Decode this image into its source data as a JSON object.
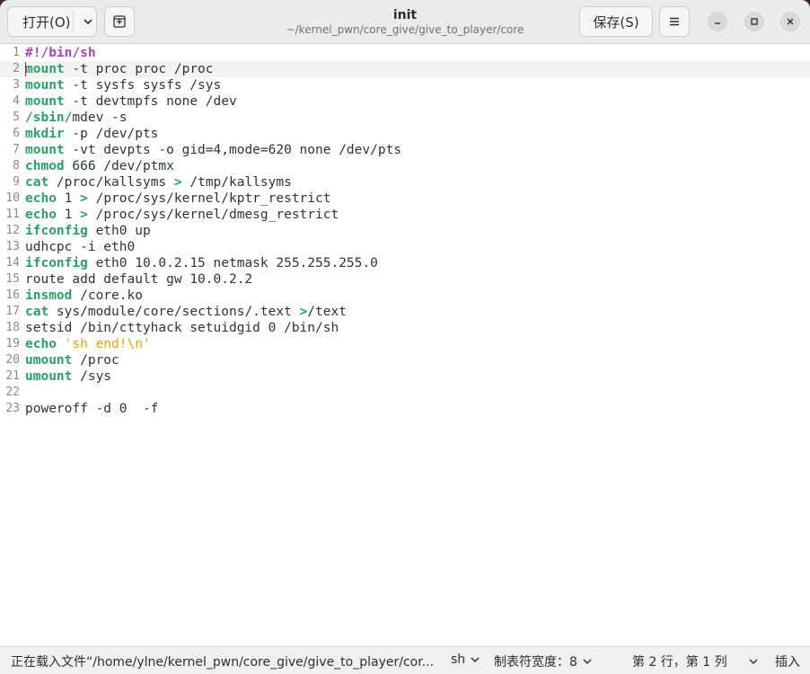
{
  "header": {
    "open_label": "打开(O)",
    "save_label": "保存(S)",
    "title": "init",
    "subtitle": "~/kernel_pwn/core_give/give_to_player/core"
  },
  "editor": {
    "current_line": 2,
    "lines": [
      {
        "n": "1",
        "segs": [
          {
            "t": "#!/bin/sh",
            "c": "sb"
          }
        ]
      },
      {
        "n": "2",
        "segs": [
          {
            "t": "mount",
            "c": "kw"
          },
          {
            "t": " -t proc proc /proc",
            "c": "plain"
          }
        ]
      },
      {
        "n": "3",
        "segs": [
          {
            "t": "mount",
            "c": "kw"
          },
          {
            "t": " -t sysfs sysfs /sys",
            "c": "plain"
          }
        ]
      },
      {
        "n": "4",
        "segs": [
          {
            "t": "mount",
            "c": "kw"
          },
          {
            "t": " -t devtmpfs none /dev",
            "c": "plain"
          }
        ]
      },
      {
        "n": "5",
        "segs": [
          {
            "t": "/sbin/",
            "c": "kw"
          },
          {
            "t": "mdev -s",
            "c": "plain"
          }
        ]
      },
      {
        "n": "6",
        "segs": [
          {
            "t": "mkdir",
            "c": "kw"
          },
          {
            "t": " -p /dev/pts",
            "c": "plain"
          }
        ]
      },
      {
        "n": "7",
        "segs": [
          {
            "t": "mount",
            "c": "kw"
          },
          {
            "t": " -vt devpts -o gid=4,mode=620 none /dev/pts",
            "c": "plain"
          }
        ]
      },
      {
        "n": "8",
        "segs": [
          {
            "t": "chmod",
            "c": "kw"
          },
          {
            "t": " 666 /dev/ptmx",
            "c": "plain"
          }
        ]
      },
      {
        "n": "9",
        "segs": [
          {
            "t": "cat",
            "c": "kw"
          },
          {
            "t": " /proc/kallsyms ",
            "c": "plain"
          },
          {
            "t": ">",
            "c": "op"
          },
          {
            "t": " /tmp/kallsyms",
            "c": "plain"
          }
        ]
      },
      {
        "n": "10",
        "segs": [
          {
            "t": "echo",
            "c": "kw"
          },
          {
            "t": " 1 ",
            "c": "plain"
          },
          {
            "t": ">",
            "c": "op"
          },
          {
            "t": " /proc/sys/kernel/kptr_restrict",
            "c": "plain"
          }
        ]
      },
      {
        "n": "11",
        "segs": [
          {
            "t": "echo",
            "c": "kw"
          },
          {
            "t": " 1 ",
            "c": "plain"
          },
          {
            "t": ">",
            "c": "op"
          },
          {
            "t": " /proc/sys/kernel/dmesg_restrict",
            "c": "plain"
          }
        ]
      },
      {
        "n": "12",
        "segs": [
          {
            "t": "ifconfig",
            "c": "kw"
          },
          {
            "t": " eth0 up",
            "c": "plain"
          }
        ]
      },
      {
        "n": "13",
        "segs": [
          {
            "t": "udhcpc -i eth0",
            "c": "plain"
          }
        ]
      },
      {
        "n": "14",
        "segs": [
          {
            "t": "ifconfig",
            "c": "kw"
          },
          {
            "t": " eth0 10.0.2.15 netmask 255.255.255.0",
            "c": "plain"
          }
        ]
      },
      {
        "n": "15",
        "segs": [
          {
            "t": "route add default gw 10.0.2.2",
            "c": "plain"
          }
        ]
      },
      {
        "n": "16",
        "segs": [
          {
            "t": "insmod",
            "c": "kw"
          },
          {
            "t": " /core.ko",
            "c": "plain"
          }
        ]
      },
      {
        "n": "17",
        "segs": [
          {
            "t": "cat",
            "c": "kw"
          },
          {
            "t": " sys/module/core/sections/.text ",
            "c": "plain"
          },
          {
            "t": ">",
            "c": "op"
          },
          {
            "t": "/text",
            "c": "plain"
          }
        ]
      },
      {
        "n": "18",
        "segs": [
          {
            "t": "setsid /bin/cttyhack setuidgid 0 /bin/sh",
            "c": "plain"
          }
        ]
      },
      {
        "n": "19",
        "segs": [
          {
            "t": "echo",
            "c": "kw"
          },
          {
            "t": " ",
            "c": "plain"
          },
          {
            "t": "'sh end!\\n'",
            "c": "str"
          }
        ]
      },
      {
        "n": "20",
        "segs": [
          {
            "t": "umount",
            "c": "kw"
          },
          {
            "t": " /proc",
            "c": "plain"
          }
        ]
      },
      {
        "n": "21",
        "segs": [
          {
            "t": "umount",
            "c": "kw"
          },
          {
            "t": " /sys",
            "c": "plain"
          }
        ]
      },
      {
        "n": "22",
        "segs": []
      },
      {
        "n": "23",
        "segs": [
          {
            "t": "poweroff -d 0  -f",
            "c": "plain"
          }
        ]
      }
    ]
  },
  "status": {
    "loading_text": "正在载入文件“/home/ylne/kernel_pwn/core_give/give_to_player/cor...",
    "language": "sh",
    "tab_width": "制表符宽度：8",
    "position": "第 2 行，第 1 列",
    "mode": "插入"
  },
  "icons": [
    "chevron-down-icon",
    "new-tab-icon",
    "hamburger-menu-icon",
    "minimize-icon",
    "maximize-icon",
    "close-icon"
  ],
  "colors": {
    "keyword": "#26a269",
    "shebang": "#a347ba",
    "string": "#e5a50a",
    "cursor": "#c7162b"
  }
}
